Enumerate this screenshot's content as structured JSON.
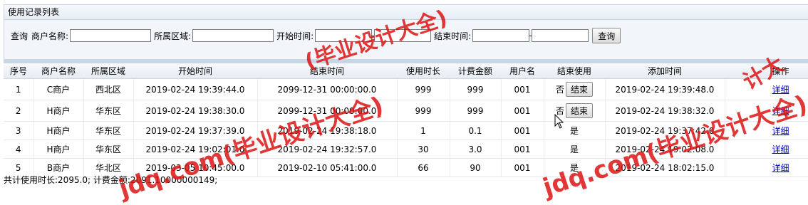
{
  "panel": {
    "title": "使用记录列表"
  },
  "search": {
    "query_label": "查询",
    "merchant_label": "商户名称:",
    "merchant_value": "",
    "region_label": "所属区域:",
    "region_value": "",
    "start_label": "开始时间:",
    "start_from": "",
    "start_to": "",
    "end_label": "结束时间:",
    "end_from": "",
    "end_to": "",
    "button_label": "查询"
  },
  "table": {
    "columns": [
      "序号",
      "商户名称",
      "所属区域",
      "开始时间",
      "结束时间",
      "使用时长",
      "计费金额",
      "用户名",
      "结束使用",
      "添加时间",
      "操作"
    ],
    "rows": [
      {
        "no": "1",
        "merchant": "C商户",
        "region": "西北区",
        "start": "2019-02-24 19:39:44.0",
        "end": "2099-12-31 00:00:00.0",
        "duration": "999",
        "amount": "999",
        "user": "001",
        "ended": "否",
        "end_button": "结束",
        "added": "2019-02-24 19:39:48.0",
        "op": "详细"
      },
      {
        "no": "2",
        "merchant": "H商户",
        "region": "华东区",
        "start": "2019-02-24 19:38:30.0",
        "end": "2099-12-31 00:00:00.0",
        "duration": "999",
        "amount": "999",
        "user": "001",
        "ended": "否",
        "end_button": "结束",
        "added": "2019-02-24 19:38:32.0",
        "op": "详细"
      },
      {
        "no": "3",
        "merchant": "H商户",
        "region": "华东区",
        "start": "2019-02-24 19:37:39.0",
        "end": "2019-02-24 19:38:18.0",
        "duration": "1",
        "amount": "0.1",
        "user": "001",
        "ended": "是",
        "end_button": "",
        "added": "2019-02-24 19:37:42.0",
        "op": "详细"
      },
      {
        "no": "4",
        "merchant": "H商户",
        "region": "华东区",
        "start": "2019-02-24 19:02:01.0",
        "end": "2019-02-24 19:32:57.0",
        "duration": "30",
        "amount": "3.0",
        "user": "001",
        "ended": "是",
        "end_button": "",
        "added": "2019-02-24 19:02:08.0",
        "op": "详细"
      },
      {
        "no": "5",
        "merchant": "B商户",
        "region": "华北区",
        "start": "2019-03-05 10:45:00.0",
        "end": "2019-02-10 05:41:00.0",
        "duration": "66",
        "amount": "90",
        "user": "001",
        "ended": "是",
        "end_button": "",
        "added": "2019-02-24 18:02:15.0",
        "op": "详细"
      }
    ]
  },
  "summary": "共计使用时长:2095.0;  计费金额:2091.10000000149;",
  "watermarks": [
    "jdq.com(毕业设计大全)",
    "jdq.com(毕业设计大全)",
    "(毕业设计大全)",
    "计大"
  ],
  "colors": {
    "watermark": "#dc1414",
    "link": "#0000cc",
    "header_border": "#c5d3e3"
  }
}
